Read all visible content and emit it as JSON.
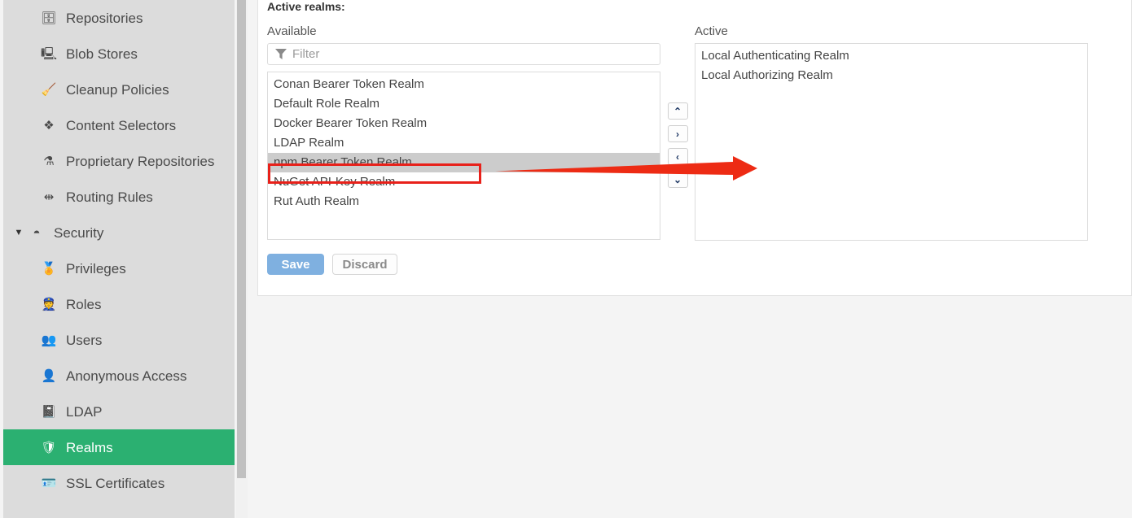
{
  "sidebar": {
    "items": [
      {
        "label": "Repositories",
        "icon": "database-icon",
        "glyph": "🗄",
        "group": false,
        "selected": false
      },
      {
        "label": "Blob Stores",
        "icon": "blob-store-icon",
        "glyph": "🖳",
        "group": false,
        "selected": false
      },
      {
        "label": "Cleanup Policies",
        "icon": "broom-icon",
        "glyph": "🧹",
        "group": false,
        "selected": false
      },
      {
        "label": "Content Selectors",
        "icon": "layers-icon",
        "glyph": "❖",
        "group": false,
        "selected": false
      },
      {
        "label": "Proprietary Repositories",
        "icon": "proprietary-icon",
        "glyph": "⚗",
        "group": false,
        "selected": false
      },
      {
        "label": "Routing Rules",
        "icon": "signpost-icon",
        "glyph": "⇹",
        "group": false,
        "selected": false
      },
      {
        "label": "Security",
        "icon": "security-icon",
        "glyph": "◓",
        "group": true,
        "selected": false,
        "caret": "▼"
      },
      {
        "label": "Privileges",
        "icon": "medal-icon",
        "glyph": "🏅",
        "group": false,
        "selected": false
      },
      {
        "label": "Roles",
        "icon": "roles-icon",
        "glyph": "👮",
        "group": false,
        "selected": false
      },
      {
        "label": "Users",
        "icon": "users-icon",
        "glyph": "👥",
        "group": false,
        "selected": false
      },
      {
        "label": "Anonymous Access",
        "icon": "person-icon",
        "glyph": "👤",
        "group": false,
        "selected": false
      },
      {
        "label": "LDAP",
        "icon": "address-book-icon",
        "glyph": "📓",
        "group": false,
        "selected": false
      },
      {
        "label": "Realms",
        "icon": "shield-icon",
        "glyph": "🛡",
        "group": false,
        "selected": true
      },
      {
        "label": "SSL Certificates",
        "icon": "certificate-icon",
        "glyph": "🪪",
        "group": false,
        "selected": false
      }
    ]
  },
  "main": {
    "section_title": "Active realms:",
    "available": {
      "label": "Available",
      "filter_placeholder": "Filter",
      "filter_value": "",
      "items": [
        {
          "label": "Conan Bearer Token Realm",
          "selected": false
        },
        {
          "label": "Default Role Realm",
          "selected": false
        },
        {
          "label": "Docker Bearer Token Realm",
          "selected": false
        },
        {
          "label": "LDAP Realm",
          "selected": false
        },
        {
          "label": "npm Bearer Token Realm",
          "selected": true
        },
        {
          "label": "NuGet API-Key Realm",
          "selected": false
        },
        {
          "label": "Rut Auth Realm",
          "selected": false
        }
      ]
    },
    "transfer_buttons": [
      {
        "name": "move-up-button",
        "glyph": "⌃"
      },
      {
        "name": "move-right-button",
        "glyph": "›"
      },
      {
        "name": "move-left-button",
        "glyph": "‹"
      },
      {
        "name": "move-down-button",
        "glyph": "⌄"
      }
    ],
    "active": {
      "label": "Active",
      "items": [
        {
          "label": "Local Authenticating Realm",
          "selected": false
        },
        {
          "label": "Local Authorizing Realm",
          "selected": false
        }
      ]
    },
    "save_label": "Save",
    "discard_label": "Discard"
  },
  "colors": {
    "accent_green": "#2bb071",
    "save_blue": "#7fb0e0",
    "annotation_red": "#e8211a",
    "sidebar_bg": "#dcdcdc"
  }
}
